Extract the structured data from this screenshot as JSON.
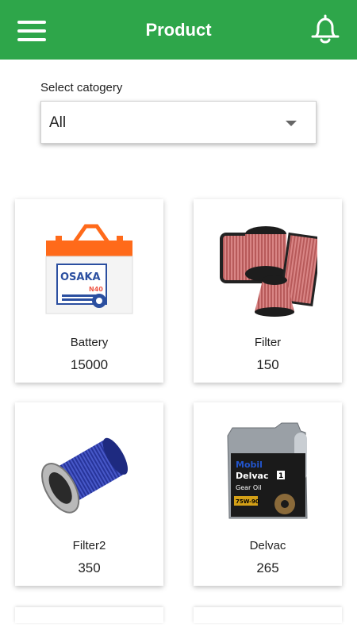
{
  "header": {
    "title": "Product",
    "menu_icon": "menu-icon",
    "bell_icon": "bell-icon",
    "color": "#2ea64a"
  },
  "filter": {
    "label": "Select catogery",
    "selected": "All"
  },
  "products": [
    {
      "name": "Battery",
      "price": "15000"
    },
    {
      "name": "Filter",
      "price": "150"
    },
    {
      "name": "Filter2",
      "price": "350"
    },
    {
      "name": "Delvac",
      "price": "265"
    }
  ]
}
